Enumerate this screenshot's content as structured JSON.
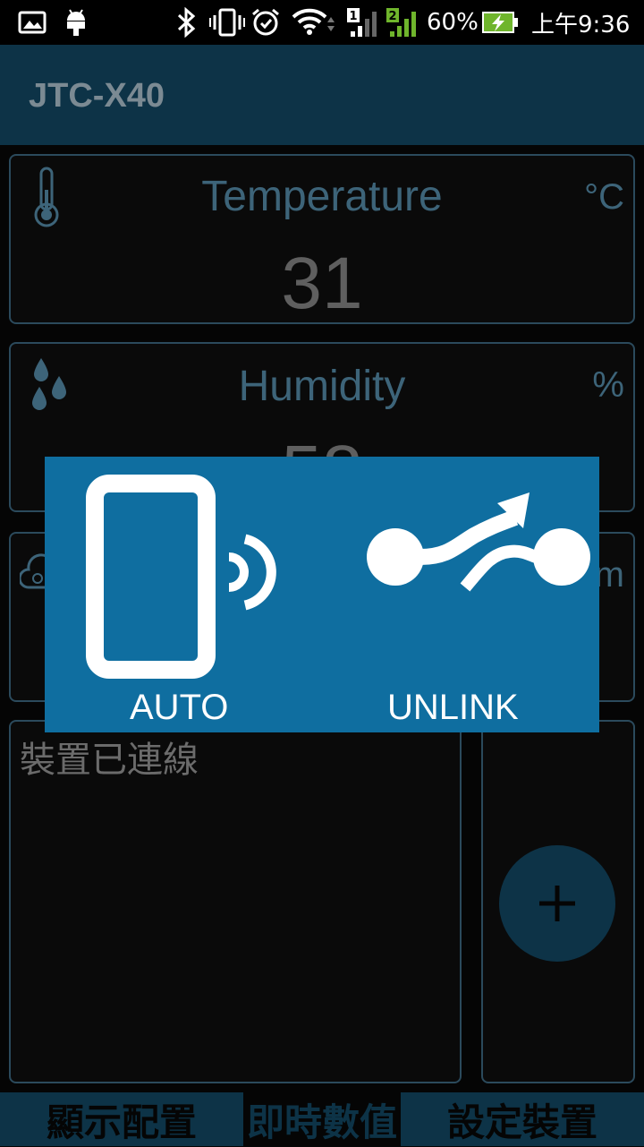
{
  "status_bar": {
    "battery_percent": "60%",
    "time": "上午9:36",
    "sim1_label": "1",
    "sim2_label": "2",
    "icons": [
      "gallery-icon",
      "android-icon",
      "bluetooth-icon",
      "vibrate-icon",
      "alarm-icon",
      "wifi-icon",
      "signal-icon",
      "battery-charging-icon"
    ]
  },
  "app_bar": {
    "title": "JTC-X40"
  },
  "cards": {
    "temperature": {
      "label": "Temperature",
      "unit": "°C",
      "value": "31",
      "icon": "thermometer-icon"
    },
    "humidity": {
      "label": "Humidity",
      "unit": "%",
      "value": "58",
      "icon": "water-drops-icon"
    },
    "co2": {
      "unit": "m",
      "icon": "cloud-co2-icon"
    }
  },
  "status_panel": {
    "text": "裝置已連線"
  },
  "fab": {
    "icon": "plus-icon"
  },
  "tabs": [
    {
      "label": "顯示配置"
    },
    {
      "label": "即時數值"
    },
    {
      "label": "設定裝置"
    }
  ],
  "popup": {
    "auto_label": "AUTO",
    "unlink_label": "UNLINK",
    "auto_icon": "phone-signal-icon",
    "unlink_icon": "unlink-icon"
  },
  "colors": {
    "app_bar": "#0d3347",
    "popup": "#0f6ea0",
    "card_border": "#2b4a5c",
    "label": "#3d6479"
  }
}
